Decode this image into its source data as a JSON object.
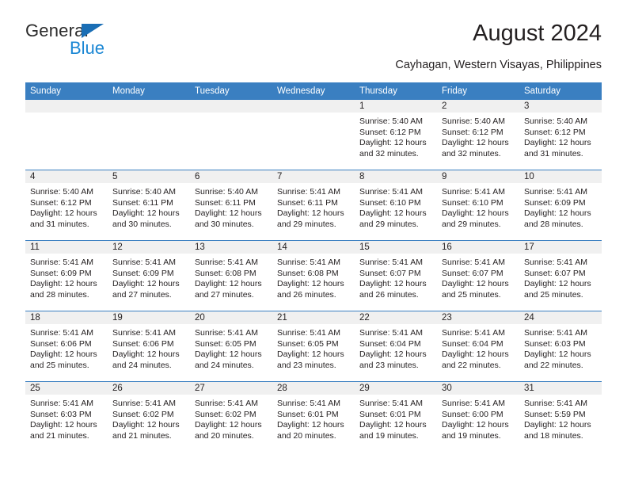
{
  "brand": {
    "word_one": "General",
    "word_two": "Blue",
    "accent_dark": "#1a6eb5",
    "accent_light": "#1b87d4"
  },
  "header": {
    "title": "August 2024",
    "subtitle": "Cayhagan, Western Visayas, Philippines",
    "header_bg": "#3a7fc1",
    "daynum_bg": "#f0f0f0"
  },
  "weekdays": [
    "Sunday",
    "Monday",
    "Tuesday",
    "Wednesday",
    "Thursday",
    "Friday",
    "Saturday"
  ],
  "weeks": [
    [
      {
        "day": "",
        "sunrise": "",
        "sunset": "",
        "daylight1": "",
        "daylight2": ""
      },
      {
        "day": "",
        "sunrise": "",
        "sunset": "",
        "daylight1": "",
        "daylight2": ""
      },
      {
        "day": "",
        "sunrise": "",
        "sunset": "",
        "daylight1": "",
        "daylight2": ""
      },
      {
        "day": "",
        "sunrise": "",
        "sunset": "",
        "daylight1": "",
        "daylight2": ""
      },
      {
        "day": "1",
        "sunrise": "Sunrise: 5:40 AM",
        "sunset": "Sunset: 6:12 PM",
        "daylight1": "Daylight: 12 hours",
        "daylight2": "and 32 minutes."
      },
      {
        "day": "2",
        "sunrise": "Sunrise: 5:40 AM",
        "sunset": "Sunset: 6:12 PM",
        "daylight1": "Daylight: 12 hours",
        "daylight2": "and 32 minutes."
      },
      {
        "day": "3",
        "sunrise": "Sunrise: 5:40 AM",
        "sunset": "Sunset: 6:12 PM",
        "daylight1": "Daylight: 12 hours",
        "daylight2": "and 31 minutes."
      }
    ],
    [
      {
        "day": "4",
        "sunrise": "Sunrise: 5:40 AM",
        "sunset": "Sunset: 6:12 PM",
        "daylight1": "Daylight: 12 hours",
        "daylight2": "and 31 minutes."
      },
      {
        "day": "5",
        "sunrise": "Sunrise: 5:40 AM",
        "sunset": "Sunset: 6:11 PM",
        "daylight1": "Daylight: 12 hours",
        "daylight2": "and 30 minutes."
      },
      {
        "day": "6",
        "sunrise": "Sunrise: 5:40 AM",
        "sunset": "Sunset: 6:11 PM",
        "daylight1": "Daylight: 12 hours",
        "daylight2": "and 30 minutes."
      },
      {
        "day": "7",
        "sunrise": "Sunrise: 5:41 AM",
        "sunset": "Sunset: 6:11 PM",
        "daylight1": "Daylight: 12 hours",
        "daylight2": "and 29 minutes."
      },
      {
        "day": "8",
        "sunrise": "Sunrise: 5:41 AM",
        "sunset": "Sunset: 6:10 PM",
        "daylight1": "Daylight: 12 hours",
        "daylight2": "and 29 minutes."
      },
      {
        "day": "9",
        "sunrise": "Sunrise: 5:41 AM",
        "sunset": "Sunset: 6:10 PM",
        "daylight1": "Daylight: 12 hours",
        "daylight2": "and 29 minutes."
      },
      {
        "day": "10",
        "sunrise": "Sunrise: 5:41 AM",
        "sunset": "Sunset: 6:09 PM",
        "daylight1": "Daylight: 12 hours",
        "daylight2": "and 28 minutes."
      }
    ],
    [
      {
        "day": "11",
        "sunrise": "Sunrise: 5:41 AM",
        "sunset": "Sunset: 6:09 PM",
        "daylight1": "Daylight: 12 hours",
        "daylight2": "and 28 minutes."
      },
      {
        "day": "12",
        "sunrise": "Sunrise: 5:41 AM",
        "sunset": "Sunset: 6:09 PM",
        "daylight1": "Daylight: 12 hours",
        "daylight2": "and 27 minutes."
      },
      {
        "day": "13",
        "sunrise": "Sunrise: 5:41 AM",
        "sunset": "Sunset: 6:08 PM",
        "daylight1": "Daylight: 12 hours",
        "daylight2": "and 27 minutes."
      },
      {
        "day": "14",
        "sunrise": "Sunrise: 5:41 AM",
        "sunset": "Sunset: 6:08 PM",
        "daylight1": "Daylight: 12 hours",
        "daylight2": "and 26 minutes."
      },
      {
        "day": "15",
        "sunrise": "Sunrise: 5:41 AM",
        "sunset": "Sunset: 6:07 PM",
        "daylight1": "Daylight: 12 hours",
        "daylight2": "and 26 minutes."
      },
      {
        "day": "16",
        "sunrise": "Sunrise: 5:41 AM",
        "sunset": "Sunset: 6:07 PM",
        "daylight1": "Daylight: 12 hours",
        "daylight2": "and 25 minutes."
      },
      {
        "day": "17",
        "sunrise": "Sunrise: 5:41 AM",
        "sunset": "Sunset: 6:07 PM",
        "daylight1": "Daylight: 12 hours",
        "daylight2": "and 25 minutes."
      }
    ],
    [
      {
        "day": "18",
        "sunrise": "Sunrise: 5:41 AM",
        "sunset": "Sunset: 6:06 PM",
        "daylight1": "Daylight: 12 hours",
        "daylight2": "and 25 minutes."
      },
      {
        "day": "19",
        "sunrise": "Sunrise: 5:41 AM",
        "sunset": "Sunset: 6:06 PM",
        "daylight1": "Daylight: 12 hours",
        "daylight2": "and 24 minutes."
      },
      {
        "day": "20",
        "sunrise": "Sunrise: 5:41 AM",
        "sunset": "Sunset: 6:05 PM",
        "daylight1": "Daylight: 12 hours",
        "daylight2": "and 24 minutes."
      },
      {
        "day": "21",
        "sunrise": "Sunrise: 5:41 AM",
        "sunset": "Sunset: 6:05 PM",
        "daylight1": "Daylight: 12 hours",
        "daylight2": "and 23 minutes."
      },
      {
        "day": "22",
        "sunrise": "Sunrise: 5:41 AM",
        "sunset": "Sunset: 6:04 PM",
        "daylight1": "Daylight: 12 hours",
        "daylight2": "and 23 minutes."
      },
      {
        "day": "23",
        "sunrise": "Sunrise: 5:41 AM",
        "sunset": "Sunset: 6:04 PM",
        "daylight1": "Daylight: 12 hours",
        "daylight2": "and 22 minutes."
      },
      {
        "day": "24",
        "sunrise": "Sunrise: 5:41 AM",
        "sunset": "Sunset: 6:03 PM",
        "daylight1": "Daylight: 12 hours",
        "daylight2": "and 22 minutes."
      }
    ],
    [
      {
        "day": "25",
        "sunrise": "Sunrise: 5:41 AM",
        "sunset": "Sunset: 6:03 PM",
        "daylight1": "Daylight: 12 hours",
        "daylight2": "and 21 minutes."
      },
      {
        "day": "26",
        "sunrise": "Sunrise: 5:41 AM",
        "sunset": "Sunset: 6:02 PM",
        "daylight1": "Daylight: 12 hours",
        "daylight2": "and 21 minutes."
      },
      {
        "day": "27",
        "sunrise": "Sunrise: 5:41 AM",
        "sunset": "Sunset: 6:02 PM",
        "daylight1": "Daylight: 12 hours",
        "daylight2": "and 20 minutes."
      },
      {
        "day": "28",
        "sunrise": "Sunrise: 5:41 AM",
        "sunset": "Sunset: 6:01 PM",
        "daylight1": "Daylight: 12 hours",
        "daylight2": "and 20 minutes."
      },
      {
        "day": "29",
        "sunrise": "Sunrise: 5:41 AM",
        "sunset": "Sunset: 6:01 PM",
        "daylight1": "Daylight: 12 hours",
        "daylight2": "and 19 minutes."
      },
      {
        "day": "30",
        "sunrise": "Sunrise: 5:41 AM",
        "sunset": "Sunset: 6:00 PM",
        "daylight1": "Daylight: 12 hours",
        "daylight2": "and 19 minutes."
      },
      {
        "day": "31",
        "sunrise": "Sunrise: 5:41 AM",
        "sunset": "Sunset: 5:59 PM",
        "daylight1": "Daylight: 12 hours",
        "daylight2": "and 18 minutes."
      }
    ]
  ]
}
